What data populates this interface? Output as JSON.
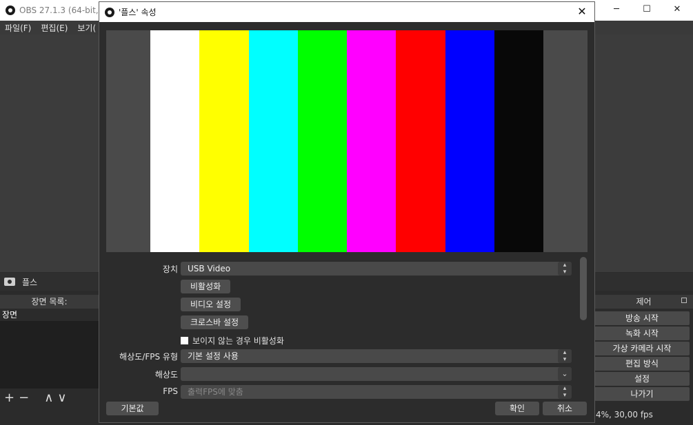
{
  "main_window": {
    "title": "OBS 27.1.3 (64-bit, w",
    "menu": [
      "파일(F)",
      "편집(E)",
      "보기("
    ],
    "source_name": "플스",
    "scenes_header": "장면 목록:",
    "scene_item": "장면",
    "scene_tools": [
      "+",
      "−",
      "∧",
      "∨"
    ],
    "controls_header": "제어",
    "controls": [
      "방송 시작",
      "녹화 시작",
      "가상 카메라 시작",
      "편집 방식",
      "설정",
      "나가기"
    ],
    "status": "4%, 30,00 fps"
  },
  "dialog": {
    "title": "'플스' 속성",
    "close_label": "✕",
    "color_bars": [
      "#ffffff",
      "#ffff00",
      "#00ffff",
      "#00ff00",
      "#ff00ff",
      "#ff0000",
      "#0000ff",
      "#080808"
    ],
    "device_label": "장치",
    "device_value": "USB Video",
    "deactivate_button": "비활성화",
    "video_settings_button": "비디오 설정",
    "crossbar_button": "크로스바 설정",
    "hide_deactivate_label": "보이지 않는 경우 비활성화",
    "res_fps_type_label": "해상도/FPS 유형",
    "res_fps_type_value": "기본 설정 사용",
    "resolution_label": "해상도",
    "resolution_value": "",
    "fps_label": "FPS",
    "fps_value": "출력FPS에 맞춤",
    "defaults_button": "기본값",
    "ok_button": "확인",
    "cancel_button": "취소"
  }
}
